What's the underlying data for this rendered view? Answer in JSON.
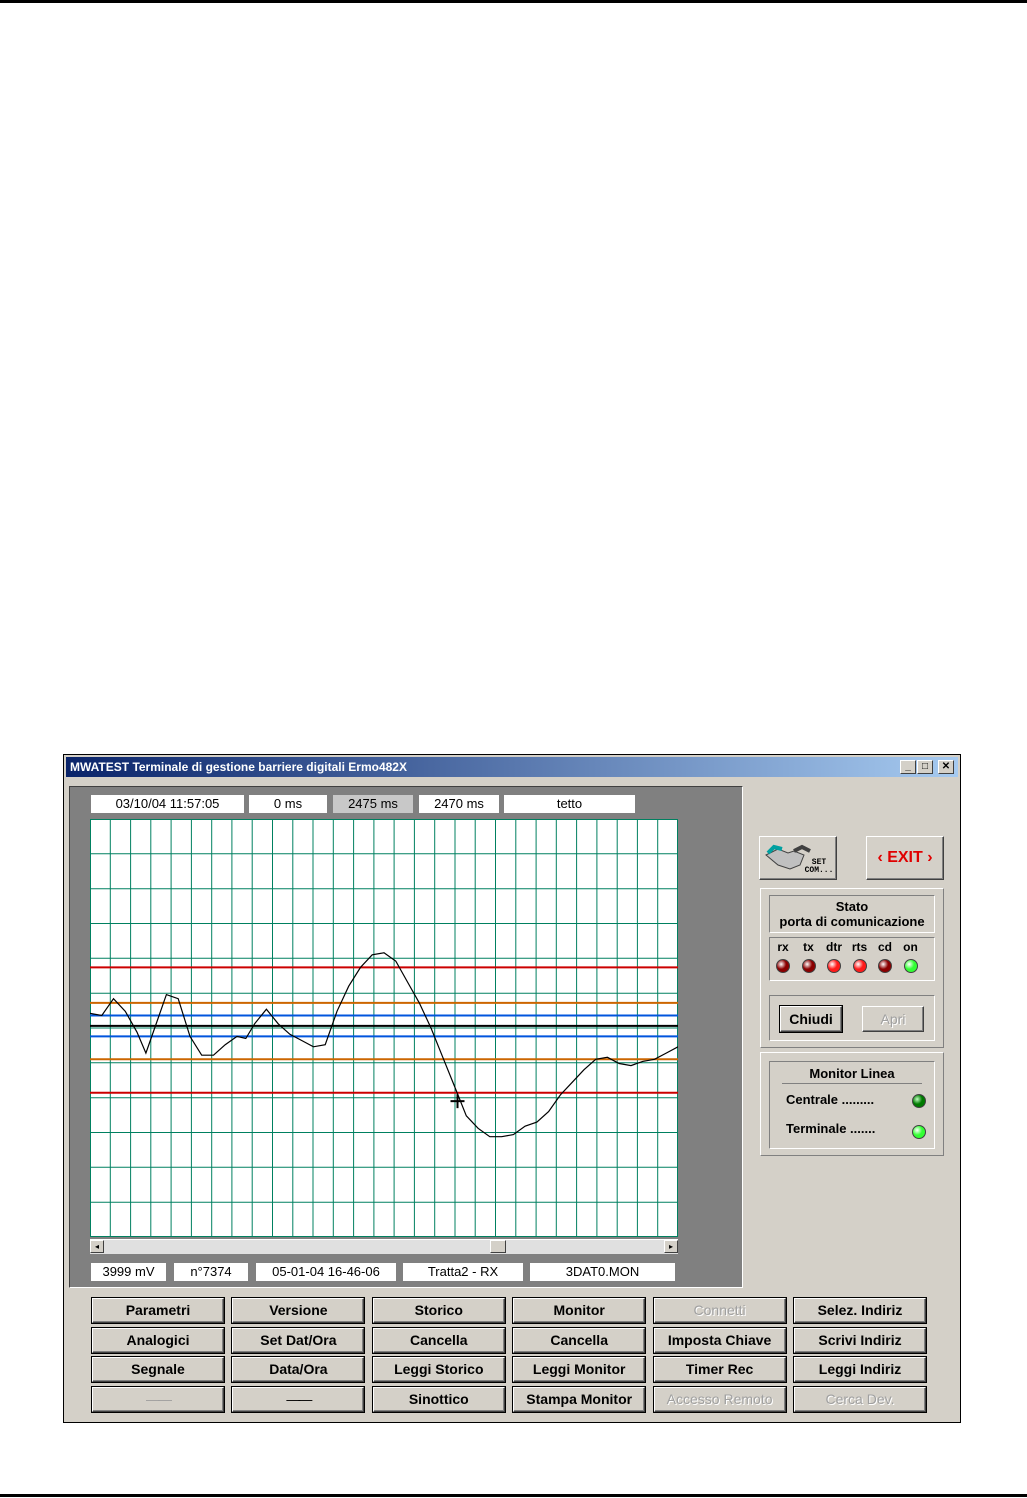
{
  "window": {
    "title": "MWATEST Terminale di gestione barriere digitali Ermo482X",
    "controls": {
      "minimize": "_",
      "maximize": "□",
      "close": "✕"
    }
  },
  "monitor": {
    "top_info": [
      "03/10/04 11:57:05",
      "0 ms",
      "2475 ms",
      "2470 ms",
      "tetto"
    ],
    "bottom_info": [
      "3999 mV",
      "n°7374",
      "05-01-04 16-46-06",
      "Tratta2 - RX",
      "3DAT0.MON"
    ]
  },
  "side": {
    "setcom_label": "SET COM...",
    "exit_label": "‹ EXIT ›",
    "stato_title_1": "Stato",
    "stato_title_2": "porta di comunicazione",
    "leds": [
      {
        "label": "rx",
        "color": "#8b0000"
      },
      {
        "label": "tx",
        "color": "#8b0000"
      },
      {
        "label": "dtr",
        "color": "#ff1a1a"
      },
      {
        "label": "rts",
        "color": "#ff1a1a"
      },
      {
        "label": "cd",
        "color": "#8b0000"
      },
      {
        "label": "on",
        "color": "#33ff33"
      }
    ],
    "chiudi_label": "Chiudi",
    "apri_label": "Apri",
    "monitor_linea_title": "Monitor Linea",
    "centrale_label": "Centrale .........",
    "terminale_label": "Terminale .......",
    "centrale_color": "#007a00",
    "terminale_color": "#33ff33"
  },
  "buttons": [
    [
      "Parametri",
      "Versione",
      "Storico",
      "Monitor",
      "Connetti",
      "Selez. Indiriz"
    ],
    [
      "Analogici",
      "Set Dat/Ora",
      "Cancella",
      "Cancella",
      "Imposta Chiave",
      "Scrivi Indiriz"
    ],
    [
      "Segnale",
      "Data/Ora",
      "Leggi Storico",
      "Leggi Monitor",
      "Timer Rec",
      "Leggi Indiriz"
    ],
    [
      "——",
      "——",
      "Sinottico",
      "Stampa Monitor",
      "Accesso Remoto",
      "Cerca Dev."
    ]
  ],
  "chart_data": {
    "type": "line",
    "grid": true,
    "grid_color": "#008060",
    "trace_color": "#000000",
    "threshold_lines": [
      {
        "y": 0.355,
        "color": "#cc0000"
      },
      {
        "y": 0.44,
        "color": "#cc6600"
      },
      {
        "y": 0.47,
        "color": "#0055dd"
      },
      {
        "y": 0.495,
        "color": "#000000"
      },
      {
        "y": 0.52,
        "color": "#0055dd"
      },
      {
        "y": 0.575,
        "color": "#cc6600"
      },
      {
        "y": 0.655,
        "color": "#cc0000"
      }
    ],
    "trace": [
      [
        0.0,
        0.465
      ],
      [
        0.02,
        0.47
      ],
      [
        0.04,
        0.43
      ],
      [
        0.06,
        0.46
      ],
      [
        0.08,
        0.51
      ],
      [
        0.095,
        0.56
      ],
      [
        0.11,
        0.5
      ],
      [
        0.13,
        0.42
      ],
      [
        0.15,
        0.43
      ],
      [
        0.17,
        0.52
      ],
      [
        0.19,
        0.565
      ],
      [
        0.21,
        0.565
      ],
      [
        0.23,
        0.54
      ],
      [
        0.25,
        0.52
      ],
      [
        0.265,
        0.525
      ],
      [
        0.28,
        0.49
      ],
      [
        0.3,
        0.455
      ],
      [
        0.32,
        0.49
      ],
      [
        0.34,
        0.515
      ],
      [
        0.36,
        0.53
      ],
      [
        0.38,
        0.545
      ],
      [
        0.4,
        0.54
      ],
      [
        0.42,
        0.46
      ],
      [
        0.44,
        0.4
      ],
      [
        0.46,
        0.355
      ],
      [
        0.48,
        0.325
      ],
      [
        0.5,
        0.32
      ],
      [
        0.52,
        0.34
      ],
      [
        0.54,
        0.39
      ],
      [
        0.56,
        0.44
      ],
      [
        0.58,
        0.5
      ],
      [
        0.6,
        0.57
      ],
      [
        0.62,
        0.64
      ],
      [
        0.64,
        0.71
      ],
      [
        0.66,
        0.74
      ],
      [
        0.68,
        0.76
      ],
      [
        0.7,
        0.76
      ],
      [
        0.72,
        0.755
      ],
      [
        0.74,
        0.735
      ],
      [
        0.76,
        0.725
      ],
      [
        0.78,
        0.7
      ],
      [
        0.8,
        0.66
      ],
      [
        0.82,
        0.63
      ],
      [
        0.84,
        0.6
      ],
      [
        0.86,
        0.575
      ],
      [
        0.88,
        0.57
      ],
      [
        0.9,
        0.585
      ],
      [
        0.92,
        0.59
      ],
      [
        0.94,
        0.58
      ],
      [
        0.96,
        0.575
      ],
      [
        0.98,
        0.56
      ],
      [
        1.0,
        0.545
      ]
    ],
    "cursor": {
      "x": 0.625,
      "y": 0.675
    }
  }
}
